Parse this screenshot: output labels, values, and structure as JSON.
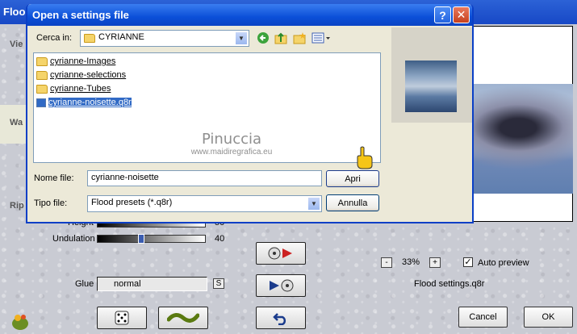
{
  "background_app": {
    "title_fragment": "Floo",
    "side_labels": [
      "Vie",
      "Wa",
      "Rip"
    ],
    "height_label": "Height",
    "height_value": "50",
    "undulation_label": "Undulation",
    "undulation_value": "40",
    "glue_label": "Glue",
    "glue_value": "normal",
    "glue_lock": "S",
    "zoom_minus": "-",
    "zoom_value": "33%",
    "zoom_plus": "+",
    "auto_preview_label": "Auto preview",
    "auto_preview_checked": true,
    "settings_file": "Flood settings.q8r",
    "cancel_label": "Cancel",
    "ok_label": "OK"
  },
  "dialog": {
    "title": "Open a settings file",
    "help": "?",
    "close": "✕",
    "lookin_label": "Cerca in:",
    "lookin_value": "CYRIANNE",
    "files": [
      {
        "name": "cyrianne-Images",
        "type": "folder",
        "selected": false
      },
      {
        "name": "cyrianne-selections",
        "type": "folder",
        "selected": false
      },
      {
        "name": "cyrianne-Tubes",
        "type": "folder",
        "selected": false
      },
      {
        "name": "cyrianne-noisette.q8r",
        "type": "file",
        "selected": true
      }
    ],
    "watermark_name": "Pinuccia",
    "watermark_url": "www.maidiregrafica.eu",
    "filename_label": "Nome file:",
    "filename_value": "cyrianne-noisette",
    "filetype_label": "Tipo file:",
    "filetype_value": "Flood presets (*.q8r)",
    "open_label": "Apri",
    "cancel_label": "Annulla"
  },
  "colors": {
    "titlebar": "#0b4fd8",
    "selection": "#316ac5",
    "dialog_bg": "#ece9d8"
  }
}
